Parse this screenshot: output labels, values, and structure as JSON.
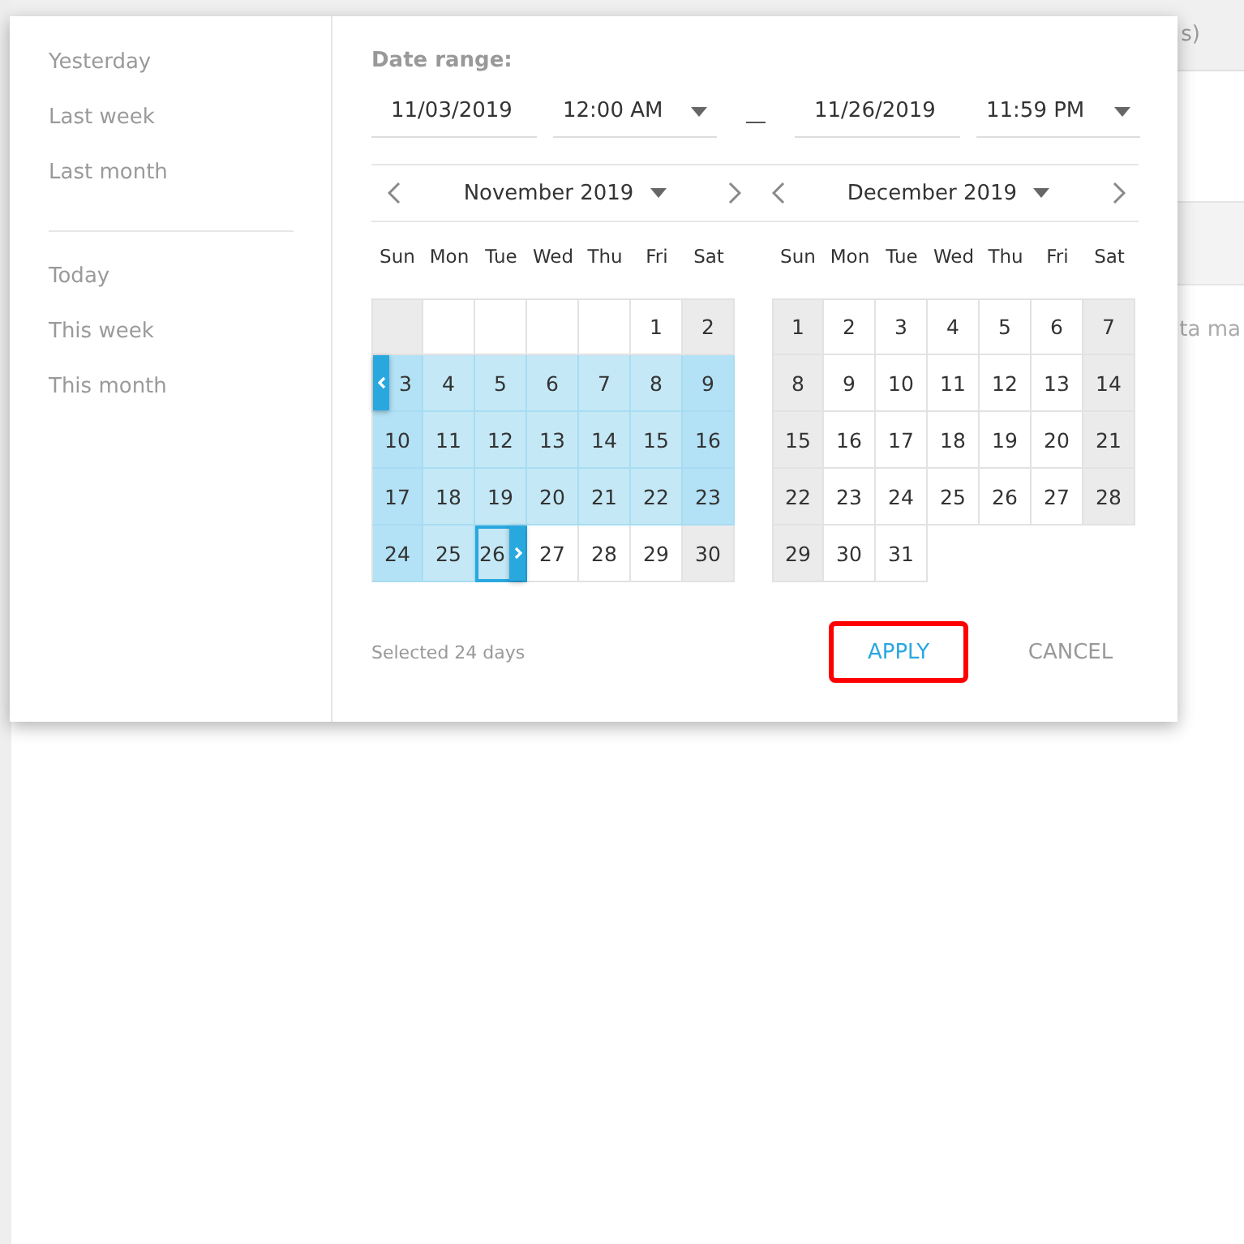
{
  "background": {
    "header_fragment": "s)",
    "body_fragment": "ta ma"
  },
  "presets": [
    {
      "label": "Yesterday",
      "separator_before": false
    },
    {
      "label": "Last week",
      "separator_before": false
    },
    {
      "label": "Last month",
      "separator_before": false
    },
    {
      "label": "Today",
      "separator_before": true
    },
    {
      "label": "This week",
      "separator_before": false
    },
    {
      "label": "This month",
      "separator_before": false
    }
  ],
  "date_range": {
    "label": "Date range:",
    "start_date": "11/03/2019",
    "start_time": "12:00 AM",
    "end_date": "11/26/2019",
    "end_time": "11:59 PM"
  },
  "months": [
    {
      "title": "November 2019",
      "weekdays": [
        "Sun",
        "Mon",
        "Tue",
        "Wed",
        "Thu",
        "Fri",
        "Sat"
      ],
      "weeks": [
        [
          {
            "kind": "blank",
            "weekend": true,
            "selected": false
          },
          {
            "kind": "blank",
            "weekend": false,
            "selected": false
          },
          {
            "kind": "blank",
            "weekend": false,
            "selected": false
          },
          {
            "kind": "blank",
            "weekend": false,
            "selected": false
          },
          {
            "kind": "blank",
            "weekend": false,
            "selected": false
          },
          {
            "kind": "day",
            "day": "1",
            "weekend": false,
            "selected": false
          },
          {
            "kind": "day",
            "day": "2",
            "weekend": true,
            "selected": false
          }
        ],
        [
          {
            "kind": "day",
            "day": "3",
            "weekend": true,
            "selected": true,
            "range_start": true
          },
          {
            "kind": "day",
            "day": "4",
            "weekend": false,
            "selected": true
          },
          {
            "kind": "day",
            "day": "5",
            "weekend": false,
            "selected": true
          },
          {
            "kind": "day",
            "day": "6",
            "weekend": false,
            "selected": true
          },
          {
            "kind": "day",
            "day": "7",
            "weekend": false,
            "selected": true
          },
          {
            "kind": "day",
            "day": "8",
            "weekend": false,
            "selected": true
          },
          {
            "kind": "day",
            "day": "9",
            "weekend": true,
            "selected": true
          }
        ],
        [
          {
            "kind": "day",
            "day": "10",
            "weekend": true,
            "selected": true
          },
          {
            "kind": "day",
            "day": "11",
            "weekend": false,
            "selected": true
          },
          {
            "kind": "day",
            "day": "12",
            "weekend": false,
            "selected": true
          },
          {
            "kind": "day",
            "day": "13",
            "weekend": false,
            "selected": true
          },
          {
            "kind": "day",
            "day": "14",
            "weekend": false,
            "selected": true
          },
          {
            "kind": "day",
            "day": "15",
            "weekend": false,
            "selected": true
          },
          {
            "kind": "day",
            "day": "16",
            "weekend": true,
            "selected": true
          }
        ],
        [
          {
            "kind": "day",
            "day": "17",
            "weekend": true,
            "selected": true
          },
          {
            "kind": "day",
            "day": "18",
            "weekend": false,
            "selected": true
          },
          {
            "kind": "day",
            "day": "19",
            "weekend": false,
            "selected": true
          },
          {
            "kind": "day",
            "day": "20",
            "weekend": false,
            "selected": true
          },
          {
            "kind": "day",
            "day": "21",
            "weekend": false,
            "selected": true
          },
          {
            "kind": "day",
            "day": "22",
            "weekend": false,
            "selected": true
          },
          {
            "kind": "day",
            "day": "23",
            "weekend": true,
            "selected": true
          }
        ],
        [
          {
            "kind": "day",
            "day": "24",
            "weekend": true,
            "selected": true
          },
          {
            "kind": "day",
            "day": "25",
            "weekend": false,
            "selected": true
          },
          {
            "kind": "day",
            "day": "26",
            "weekend": false,
            "selected": true,
            "range_end": true
          },
          {
            "kind": "day",
            "day": "27",
            "weekend": false,
            "selected": false
          },
          {
            "kind": "day",
            "day": "28",
            "weekend": false,
            "selected": false
          },
          {
            "kind": "day",
            "day": "29",
            "weekend": false,
            "selected": false
          },
          {
            "kind": "day",
            "day": "30",
            "weekend": true,
            "selected": false
          }
        ]
      ]
    },
    {
      "title": "December 2019",
      "weekdays": [
        "Sun",
        "Mon",
        "Tue",
        "Wed",
        "Thu",
        "Fri",
        "Sat"
      ],
      "weeks": [
        [
          {
            "kind": "day",
            "day": "1",
            "weekend": true,
            "selected": false
          },
          {
            "kind": "day",
            "day": "2",
            "weekend": false,
            "selected": false
          },
          {
            "kind": "day",
            "day": "3",
            "weekend": false,
            "selected": false
          },
          {
            "kind": "day",
            "day": "4",
            "weekend": false,
            "selected": false
          },
          {
            "kind": "day",
            "day": "5",
            "weekend": false,
            "selected": false
          },
          {
            "kind": "day",
            "day": "6",
            "weekend": false,
            "selected": false
          },
          {
            "kind": "day",
            "day": "7",
            "weekend": true,
            "selected": false
          }
        ],
        [
          {
            "kind": "day",
            "day": "8",
            "weekend": true,
            "selected": false
          },
          {
            "kind": "day",
            "day": "9",
            "weekend": false,
            "selected": false
          },
          {
            "kind": "day",
            "day": "10",
            "weekend": false,
            "selected": false
          },
          {
            "kind": "day",
            "day": "11",
            "weekend": false,
            "selected": false
          },
          {
            "kind": "day",
            "day": "12",
            "weekend": false,
            "selected": false
          },
          {
            "kind": "day",
            "day": "13",
            "weekend": false,
            "selected": false
          },
          {
            "kind": "day",
            "day": "14",
            "weekend": true,
            "selected": false
          }
        ],
        [
          {
            "kind": "day",
            "day": "15",
            "weekend": true,
            "selected": false
          },
          {
            "kind": "day",
            "day": "16",
            "weekend": false,
            "selected": false
          },
          {
            "kind": "day",
            "day": "17",
            "weekend": false,
            "selected": false
          },
          {
            "kind": "day",
            "day": "18",
            "weekend": false,
            "selected": false
          },
          {
            "kind": "day",
            "day": "19",
            "weekend": false,
            "selected": false
          },
          {
            "kind": "day",
            "day": "20",
            "weekend": false,
            "selected": false
          },
          {
            "kind": "day",
            "day": "21",
            "weekend": true,
            "selected": false
          }
        ],
        [
          {
            "kind": "day",
            "day": "22",
            "weekend": true,
            "selected": false
          },
          {
            "kind": "day",
            "day": "23",
            "weekend": false,
            "selected": false
          },
          {
            "kind": "day",
            "day": "24",
            "weekend": false,
            "selected": false
          },
          {
            "kind": "day",
            "day": "25",
            "weekend": false,
            "selected": false
          },
          {
            "kind": "day",
            "day": "26",
            "weekend": false,
            "selected": false
          },
          {
            "kind": "day",
            "day": "27",
            "weekend": false,
            "selected": false
          },
          {
            "kind": "day",
            "day": "28",
            "weekend": true,
            "selected": false
          }
        ],
        [
          {
            "kind": "day",
            "day": "29",
            "weekend": true,
            "selected": false
          },
          {
            "kind": "day",
            "day": "30",
            "weekend": false,
            "selected": false
          },
          {
            "kind": "day",
            "day": "31",
            "weekend": false,
            "selected": false
          }
        ]
      ]
    }
  ],
  "summary": "Selected 24 days",
  "buttons": [
    {
      "label": "APPLY",
      "kind": "primary",
      "highlighted": true
    },
    {
      "label": "CANCEL",
      "kind": "secondary",
      "highlighted": false
    }
  ]
}
